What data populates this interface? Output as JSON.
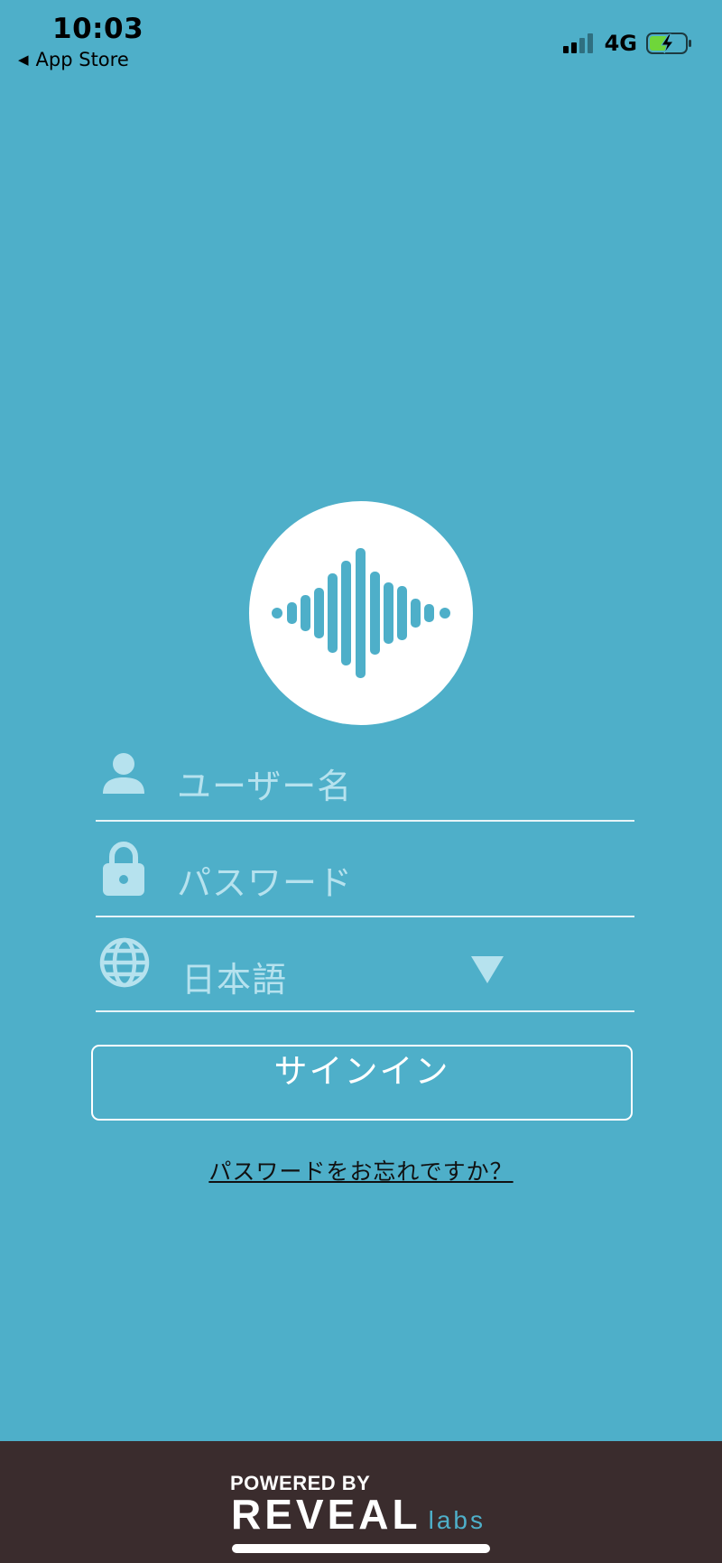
{
  "status_bar": {
    "time": "10:03",
    "back_label": "App Store",
    "network": "4G",
    "signal_bars": 2,
    "signal_bars_total": 4,
    "battery_state": "charging"
  },
  "login": {
    "username_placeholder": "ユーザー名",
    "password_placeholder": "パスワード",
    "language_value": "日本語",
    "signin_label": "サインイン",
    "forgot_label": "パスワードをお忘れですか？"
  },
  "footer": {
    "powered_by": "POWERED BY",
    "brand_main": "REVEAL",
    "brand_sub": "labs"
  },
  "colors": {
    "background": "#4eafc9",
    "footer": "#3a2c2d",
    "icon": "#b6e2ee"
  },
  "icons": {
    "logo": "sound-waveform-icon",
    "username": "user-icon",
    "password": "lock-icon",
    "language": "globe-icon",
    "language_dropdown": "triangle-down-icon"
  }
}
